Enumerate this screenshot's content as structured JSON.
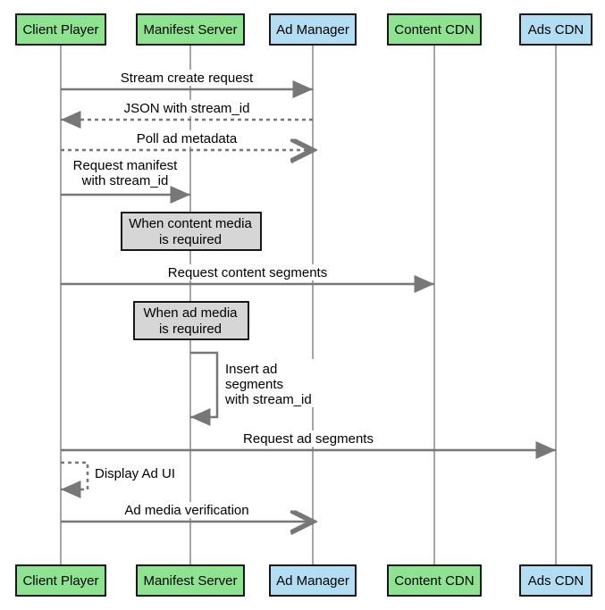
{
  "actors": {
    "client": {
      "label": "Client Player"
    },
    "manifest": {
      "label": "Manifest Server"
    },
    "admgr": {
      "label": "Ad Manager"
    },
    "ccdn": {
      "label": "Content CDN"
    },
    "acdn": {
      "label": "Ads CDN"
    }
  },
  "messages": {
    "m1": "Stream create request",
    "m2": "JSON with stream_id",
    "m3": "Poll ad metadata",
    "m4a": "Request manifest",
    "m4b": "with stream_id",
    "n1a": "When content media",
    "n1b": "is required",
    "m5": "Request content segments",
    "n2a": "When ad media",
    "n2b": "is required",
    "m6a": "Insert ad",
    "m6b": "segments",
    "m6c": "with stream_id",
    "m7": "Request ad segments",
    "m8": "Display Ad UI",
    "m9": "Ad media verification"
  },
  "chart_data": {
    "type": "table",
    "title": "Sequence diagram of ad-enabled streaming flow",
    "actors": [
      {
        "id": "client",
        "name": "Client Player",
        "color": "green"
      },
      {
        "id": "manifest",
        "name": "Manifest Server",
        "color": "green"
      },
      {
        "id": "admgr",
        "name": "Ad Manager",
        "color": "blue"
      },
      {
        "id": "ccdn",
        "name": "Content CDN",
        "color": "green"
      },
      {
        "id": "acdn",
        "name": "Ads CDN",
        "color": "blue"
      }
    ],
    "interactions": [
      {
        "from": "client",
        "to": "admgr",
        "label": "Stream create request",
        "style": "solid"
      },
      {
        "from": "admgr",
        "to": "client",
        "label": "JSON with stream_id",
        "style": "dashed"
      },
      {
        "from": "client",
        "to": "admgr",
        "label": "Poll ad metadata",
        "style": "dashed"
      },
      {
        "from": "client",
        "to": "manifest",
        "label": "Request manifest with stream_id",
        "style": "solid"
      },
      {
        "type": "note",
        "over": "manifest",
        "label": "When content media is required"
      },
      {
        "from": "client",
        "to": "ccdn",
        "label": "Request content segments",
        "style": "solid"
      },
      {
        "type": "note",
        "over": "manifest",
        "label": "When ad media is required"
      },
      {
        "from": "manifest",
        "to": "manifest",
        "label": "Insert ad segments with stream_id",
        "style": "solid"
      },
      {
        "from": "client",
        "to": "acdn",
        "label": "Request ad segments",
        "style": "solid"
      },
      {
        "from": "client",
        "to": "client",
        "label": "Display Ad UI",
        "style": "dashed"
      },
      {
        "from": "client",
        "to": "admgr",
        "label": "Ad media verification",
        "style": "solid"
      }
    ]
  }
}
